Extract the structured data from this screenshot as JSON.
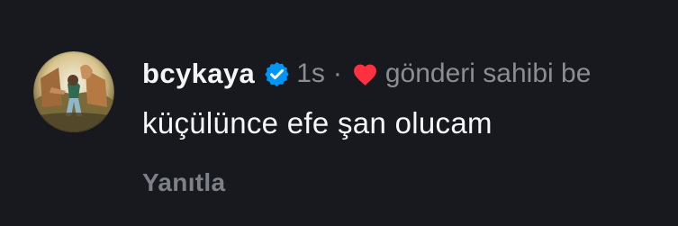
{
  "comment": {
    "username": "bcykaya",
    "timestamp": "1s",
    "separator": "·",
    "liked_by_text": "gönderi sahibi be",
    "text": "küçülünce efe şan olucam",
    "reply_label": "Yanıtla"
  },
  "icons": {
    "verified": "verified-badge-icon",
    "heart": "heart-icon"
  },
  "colors": {
    "background": "#17191e",
    "verified_blue": "#0095f6",
    "heart_red": "#ff3040",
    "secondary_text": "#8a8d93"
  }
}
